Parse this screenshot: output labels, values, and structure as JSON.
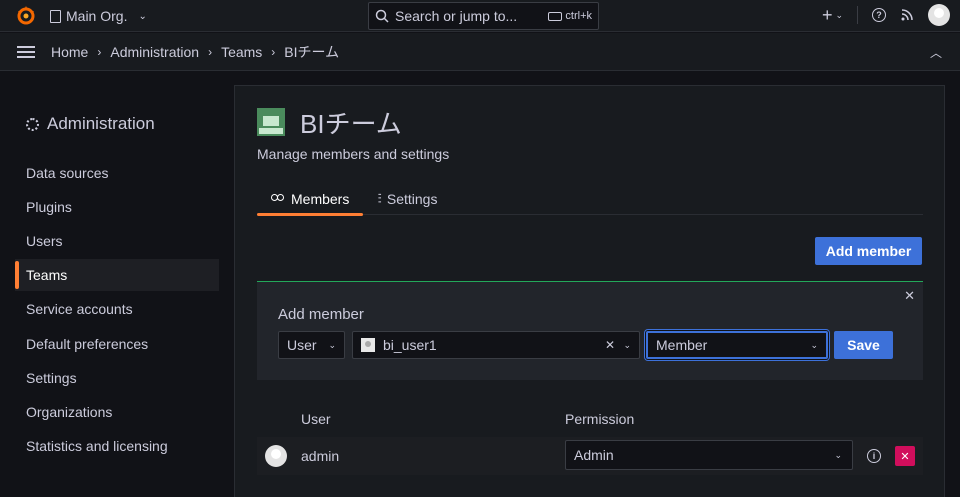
{
  "topbar": {
    "logo_icon": "grafana-logo-icon",
    "org_name": "Main Org.",
    "search_placeholder": "Search or jump to...",
    "search_shortcut": "ctrl+k",
    "plus_label": "+"
  },
  "breadcrumb": {
    "items": [
      "Home",
      "Administration",
      "Teams",
      "BIチーム"
    ]
  },
  "sidebar": {
    "title": "Administration",
    "items": [
      {
        "label": "Data sources"
      },
      {
        "label": "Plugins"
      },
      {
        "label": "Users"
      },
      {
        "label": "Teams",
        "active": true
      },
      {
        "label": "Service accounts"
      },
      {
        "label": "Default preferences"
      },
      {
        "label": "Settings"
      },
      {
        "label": "Organizations"
      },
      {
        "label": "Statistics and licensing"
      }
    ]
  },
  "team": {
    "name": "BIチーム",
    "subtitle": "Manage members and settings"
  },
  "tabs": [
    {
      "label": "Members",
      "active": true,
      "icon": "users-icon"
    },
    {
      "label": "Settings",
      "active": false,
      "icon": "sliders-icon"
    }
  ],
  "add_member_button": "Add member",
  "add_member_form": {
    "title": "Add member",
    "type_value": "User",
    "user_value": "bi_user1",
    "role_value": "Member",
    "save_label": "Save"
  },
  "members_table": {
    "columns": [
      "User",
      "Permission"
    ],
    "rows": [
      {
        "user": "admin",
        "permission": "Admin"
      }
    ]
  },
  "colors": {
    "accent": "#3d71d9",
    "active_tab": "#ff7f34",
    "delete": "#d10e5c",
    "form_border": "#23a85a"
  }
}
